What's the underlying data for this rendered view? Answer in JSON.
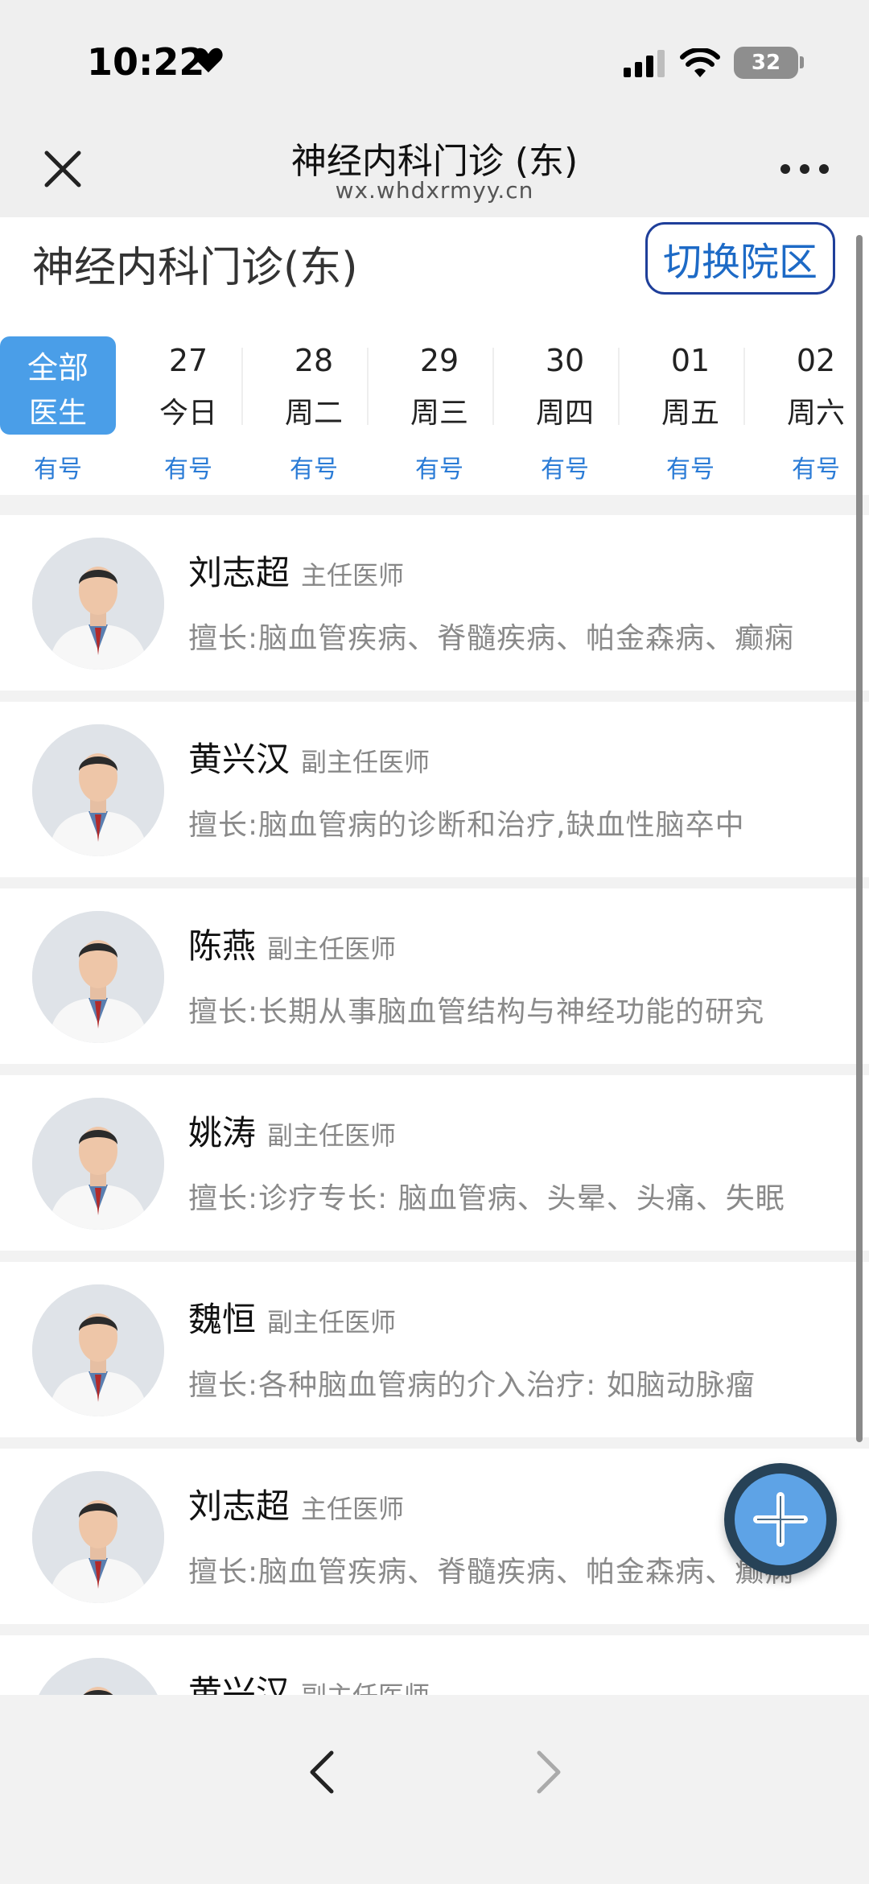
{
  "status_bar": {
    "time": "10:22",
    "battery": "32"
  },
  "nav": {
    "title": "神经内科门诊 (东)",
    "subtitle": "wx.whdxrmyy.cn"
  },
  "header": {
    "dept_title": "神经内科门诊(东)",
    "switch_label": "切换院区"
  },
  "dates": [
    {
      "line1": "全部",
      "line2": "医生",
      "avail": "有号",
      "selected": true
    },
    {
      "line1": "27",
      "line2": "今日",
      "avail": "有号"
    },
    {
      "line1": "28",
      "line2": "周二",
      "avail": "有号"
    },
    {
      "line1": "29",
      "line2": "周三",
      "avail": "有号"
    },
    {
      "line1": "30",
      "line2": "周四",
      "avail": "有号"
    },
    {
      "line1": "01",
      "line2": "周五",
      "avail": "有号"
    },
    {
      "line1": "02",
      "line2": "周六",
      "avail": "有号"
    }
  ],
  "doctors": [
    {
      "name": "刘志超",
      "title": "主任医师",
      "skill": "擅长:脑血管疾病、脊髓疾病、帕金森病、癫痫"
    },
    {
      "name": "黄兴汉",
      "title": "副主任医师",
      "skill": "擅长:脑血管病的诊断和治疗,缺血性脑卒中"
    },
    {
      "name": "陈燕",
      "title": "副主任医师",
      "skill": "擅长:长期从事脑血管结构与神经功能的研究"
    },
    {
      "name": "姚涛",
      "title": "副主任医师",
      "skill": "擅长:诊疗专长: 脑血管病、头晕、头痛、失眠"
    },
    {
      "name": "魏恒",
      "title": "副主任医师",
      "skill": "擅长:各种脑血管病的介入治疗: 如脑动脉瘤"
    },
    {
      "name": "刘志超",
      "title": "主任医师",
      "skill": "擅长:脑血管疾病、脊髓疾病、帕金森病、癫痫"
    },
    {
      "name": "黄兴汉",
      "title": "副主任医师",
      "skill": ""
    }
  ],
  "colors": {
    "accent": "#4a9ee8",
    "link": "#2a7bd6",
    "fab": "#5ea3e6"
  },
  "icons": {
    "close": "close-icon",
    "more": "more-icon",
    "add": "plus-icon",
    "back": "chevron-left-icon",
    "forward": "chevron-right-icon"
  }
}
